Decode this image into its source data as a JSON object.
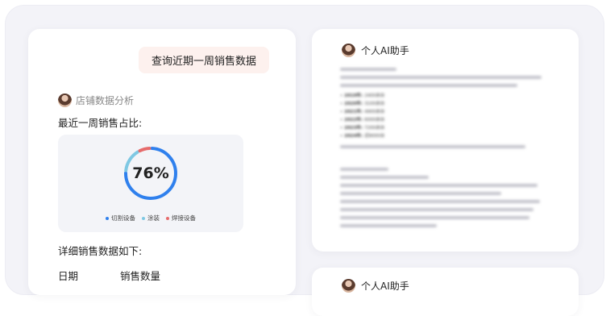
{
  "query": "查询近期一周销售数据",
  "assistant": {
    "name": "店铺数据分析"
  },
  "section_share": "最近一周销售占比:",
  "chart_data": {
    "type": "pie",
    "center_label": "76%",
    "categories": [
      "切割设备",
      "涂装",
      "焊接设备"
    ],
    "colors": [
      "#2f80ed",
      "#7ec8e3",
      "#e66b6b"
    ],
    "values": [
      76,
      16,
      8
    ]
  },
  "section_detail": "详细销售数据如下:",
  "table": {
    "columns": [
      "日期",
      "销售数量"
    ]
  },
  "right_panel": {
    "title": "个人AI助手",
    "title_2": "个人AI助手",
    "years": [
      {
        "year": "2019年:",
        "value": "2400余台"
      },
      {
        "year": "2020年:",
        "value": "3100余台"
      },
      {
        "year": "2021年:",
        "value": "4900余台"
      },
      {
        "year": "2022年:",
        "value": "6000余台"
      },
      {
        "year": "2023年:",
        "value": "7200余台"
      },
      {
        "year": "2024年:",
        "value": "近8000台"
      }
    ]
  }
}
